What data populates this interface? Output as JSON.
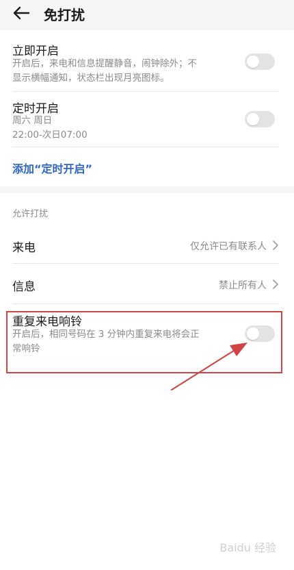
{
  "header": {
    "title": "免打扰"
  },
  "card1": {
    "immediate": {
      "title": "立即开启",
      "desc": [
        "开启后，来电和信息提醒静音，闹钟除外；不",
        "显示横幅通知，状态栏出现月亮图标。"
      ],
      "toggle_on": false
    },
    "scheduled": {
      "title": "定时开启",
      "days": "周六 周日",
      "time": "22:00-次日07:00",
      "toggle_on": false
    },
    "add_link": "添加“定时开启”"
  },
  "card2": {
    "section_label": "允许打扰",
    "calls": {
      "title": "来电",
      "value": "仅允许已有联系人"
    },
    "messages": {
      "title": "信息",
      "value": "禁止所有人"
    },
    "repeat": {
      "title": "重复来电响铃",
      "desc": [
        "开启后，相同号码在 3 分钟内重复来电将会正",
        "常响铃"
      ],
      "toggle_on": false
    }
  },
  "colors": {
    "link": "#2e64c8",
    "annotation": "#d24545",
    "toggle_off": "#e3e3e3"
  },
  "watermark": "Baidu 经验"
}
